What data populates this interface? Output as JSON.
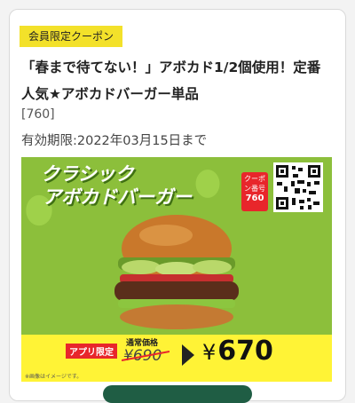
{
  "coupon": {
    "badge": "会員限定クーポン",
    "title": "「春まで待てない！」アボカド1/2個使用！定番人気★アボカドバーガー単品",
    "code": "[760]",
    "expiry": "有効期限:2022年03月15日まで"
  },
  "banner": {
    "title_line1": "クラシック",
    "title_line2": "アボカドバーガー",
    "number_tag_label": "クーポン番号",
    "number_tag_value": "760",
    "qr_icon": "qr-code-icon",
    "app_only": "アプリ限定",
    "regular_label": "通常価格",
    "regular_price": "¥690",
    "price_yen": "¥",
    "price_value": "670",
    "disclaimer": "※画像はイメージです。"
  },
  "colors": {
    "badge": "#f3e12a",
    "banner_bg": "#8cbf3b",
    "price_bar": "#fff336",
    "accent_red": "#e8262b",
    "button": "#1f5d44"
  }
}
